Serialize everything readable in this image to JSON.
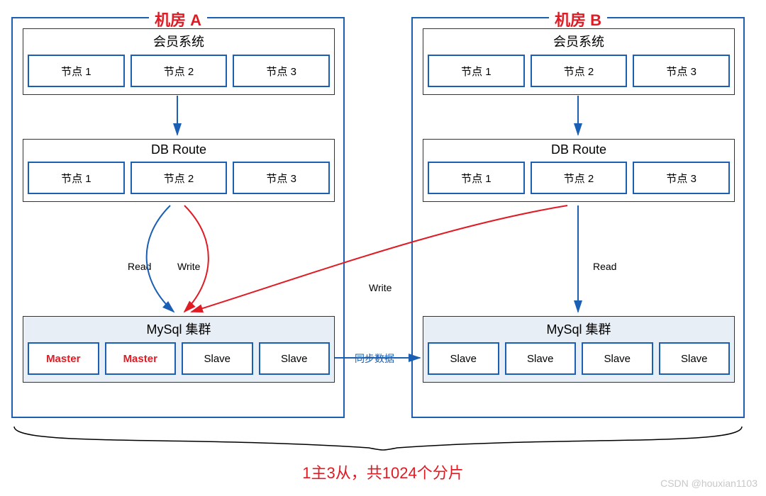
{
  "dcA": {
    "title": "机房 A",
    "member": {
      "title": "会员系统",
      "nodes": [
        "节点 1",
        "节点 2",
        "节点 3"
      ]
    },
    "dbroute": {
      "title": "DB Route",
      "nodes": [
        "节点 1",
        "节点 2",
        "节点 3"
      ]
    },
    "mysql": {
      "title": "MySql 集群",
      "nodes": [
        "Master",
        "Master",
        "Slave",
        "Slave"
      ]
    },
    "read": "Read",
    "write": "Write"
  },
  "dcB": {
    "title": "机房 B",
    "member": {
      "title": "会员系统",
      "nodes": [
        "节点 1",
        "节点 2",
        "节点 3"
      ]
    },
    "dbroute": {
      "title": "DB Route",
      "nodes": [
        "节点 1",
        "节点 2",
        "节点 3"
      ]
    },
    "mysql": {
      "title": "MySql 集群",
      "nodes": [
        "Slave",
        "Slave",
        "Slave",
        "Slave"
      ]
    },
    "read": "Read",
    "write": "Write"
  },
  "sync": "同步数据",
  "caption": "1主3从，共1024个分片",
  "watermark": "CSDN @houxian1103",
  "colors": {
    "blue": "#1a5fb4",
    "red": "#e01b24",
    "fill": "#e8eef6"
  }
}
